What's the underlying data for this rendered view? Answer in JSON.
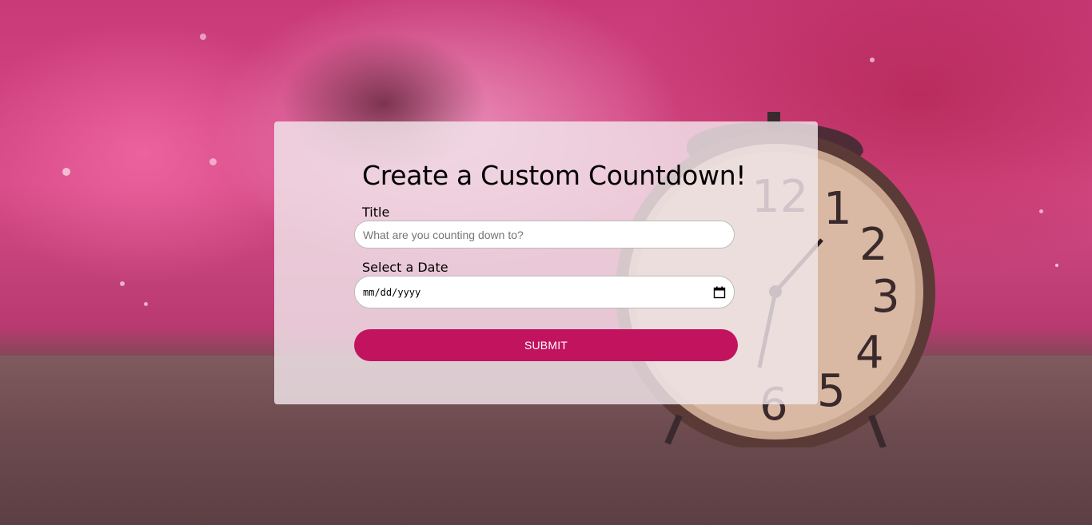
{
  "form": {
    "heading": "Create a Custom Countdown!",
    "title_label": "Title",
    "title_placeholder": "What are you counting down to?",
    "title_value": "",
    "date_label": "Select a Date",
    "date_value": "mm/dd/yyyy",
    "submit_label": "SUBMIT"
  },
  "colors": {
    "accent": "#c2135e",
    "card_background": "#f2e6ec"
  },
  "icons": {
    "date_picker": "calendar-icon"
  }
}
